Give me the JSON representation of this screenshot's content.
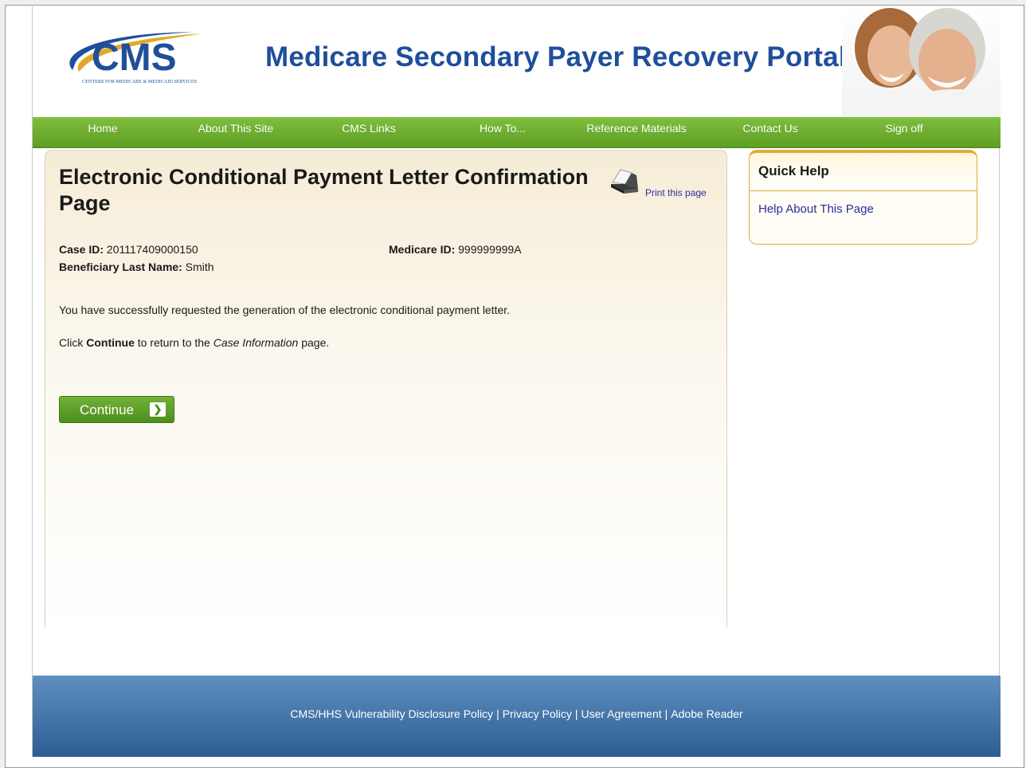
{
  "header": {
    "logo_text": "CMS",
    "logo_subtext": "CENTERS FOR MEDICARE & MEDICAID SERVICES",
    "portal_title": "Medicare Secondary Payer Recovery Portal"
  },
  "nav": {
    "items": [
      "Home",
      "About This Site",
      "CMS Links",
      "How To...",
      "Reference Materials",
      "Contact Us",
      "Sign off"
    ]
  },
  "main": {
    "heading": "Electronic Conditional Payment Letter Confirmation Page",
    "print_label": "Print this page",
    "case_id_label": "Case ID:",
    "case_id_value": "201117409000150",
    "medicare_id_label": "Medicare ID:",
    "medicare_id_value": "999999999A",
    "beneficiary_label": "Beneficiary Last Name:",
    "beneficiary_value": "Smith",
    "success_message": "You have successfully requested the generation of the electronic conditional payment letter.",
    "instruction_prefix": "Click ",
    "instruction_bold": "Continue",
    "instruction_middle": " to return to the ",
    "instruction_italic": "Case Information",
    "instruction_suffix": " page.",
    "continue_label": "Continue"
  },
  "quick_help": {
    "title": "Quick Help",
    "link": "Help About This Page"
  },
  "footer": {
    "links": [
      "CMS/HHS Vulnerability Disclosure Policy",
      "Privacy Policy",
      "User Agreement",
      "Adobe Reader"
    ],
    "separator": "|"
  },
  "colors": {
    "title_blue": "#1f4e9b",
    "nav_green": "#6aab2e",
    "footer_blue": "#3f6fa4",
    "quick_help_border": "#e3a83a",
    "link": "#2c2ca0"
  }
}
